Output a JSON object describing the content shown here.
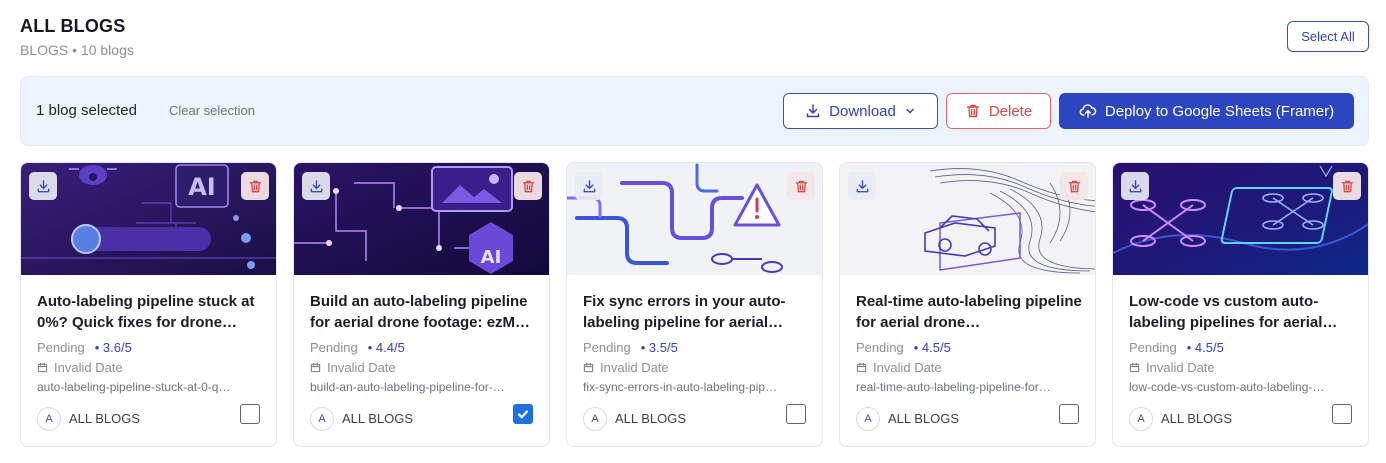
{
  "header": {
    "title": "ALL BLOGS",
    "subtitle": "BLOGS • 10 blogs",
    "select_all_label": "Select All"
  },
  "selection_bar": {
    "count_text": "1 blog selected",
    "clear_label": "Clear selection",
    "download_label": "Download",
    "delete_label": "Delete",
    "deploy_label": "Deploy to Google Sheets (Framer)"
  },
  "cards": [
    {
      "title": "Auto-labeling pipeline stuck at 0%? Quick fixes for drone…",
      "status": "Pending",
      "rating": "• 3.6/5",
      "date": "Invalid Date",
      "slug": "auto-labeling-pipeline-stuck-at-0-q…",
      "avatar": "A",
      "author": "ALL BLOGS",
      "checked": false,
      "thumb_icon": "ai-drone-illustration"
    },
    {
      "title": "Build an auto-labeling pipeline for aerial drone footage: ezM…",
      "status": "Pending",
      "rating": "• 4.4/5",
      "date": "Invalid Date",
      "slug": "build-an-auto-labeling-pipeline-for-…",
      "avatar": "A",
      "author": "ALL BLOGS",
      "checked": true,
      "thumb_icon": "circuit-image-ai-illustration"
    },
    {
      "title": "Fix sync errors in your auto-labeling pipeline for aerial…",
      "status": "Pending",
      "rating": "• 3.5/5",
      "date": "Invalid Date",
      "slug": "fix-sync-errors-in-auto-labeling-pip…",
      "avatar": "A",
      "author": "ALL BLOGS",
      "checked": false,
      "thumb_icon": "pipes-warning-illustration"
    },
    {
      "title": "Real-time auto-labeling pipeline for aerial drone…",
      "status": "Pending",
      "rating": "• 4.5/5",
      "date": "Invalid Date",
      "slug": "real-time-auto-labeling-pipeline-for…",
      "avatar": "A",
      "author": "ALL BLOGS",
      "checked": false,
      "thumb_icon": "wireframe-car-illustration"
    },
    {
      "title": "Low-code vs custom auto-labeling pipelines for aerial…",
      "status": "Pending",
      "rating": "• 4.5/5",
      "date": "Invalid Date",
      "slug": "low-code-vs-custom-auto-labeling-…",
      "avatar": "A",
      "author": "ALL BLOGS",
      "checked": false,
      "thumb_icon": "neon-drones-illustration"
    }
  ],
  "colors": {
    "accent": "#2c46c2",
    "danger": "#d94848",
    "checkbox_checked": "#1f6fe0",
    "selection_bar_bg": "#eef4fd"
  }
}
